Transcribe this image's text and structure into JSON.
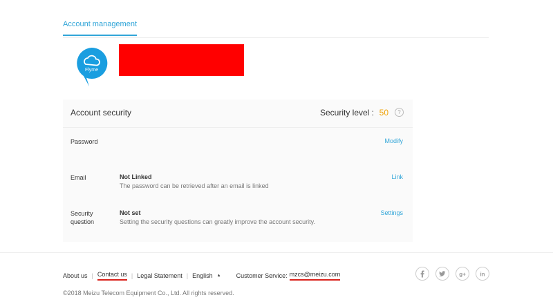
{
  "tabs": [
    {
      "label": "Account management",
      "active": true
    }
  ],
  "profile": {
    "avatar_brand": "Flyme",
    "redaction_color": "#ff0000"
  },
  "security": {
    "title": "Account security",
    "level_label": "Security level :",
    "level_value": "50",
    "help_icon": "question-icon",
    "rows": [
      {
        "label": "Password",
        "status": "",
        "description": "",
        "action": "Modify"
      },
      {
        "label": "Email",
        "status": "Not Linked",
        "description": "The password can be retrieved after an email is linked",
        "action": "Link"
      },
      {
        "label": "Security question",
        "status": "Not set",
        "description": "Setting the security questions can greatly improve the account security.",
        "action": "Settings"
      }
    ]
  },
  "footer": {
    "links": [
      "About us",
      "Contact us",
      "Legal Statement",
      "English"
    ],
    "customer_service_label": "Customer Service:",
    "customer_service_email": "mzcs@meizu.com",
    "social_icons": [
      "facebook-icon",
      "twitter-icon",
      "google-plus-icon",
      "linkedin-icon"
    ],
    "copyright": "©2018 Meizu Telecom Equipment Co., Ltd. All rights reserved."
  },
  "colors": {
    "accent": "#31a5d8",
    "level": "#f0a30a",
    "underline": "#d9201a"
  }
}
